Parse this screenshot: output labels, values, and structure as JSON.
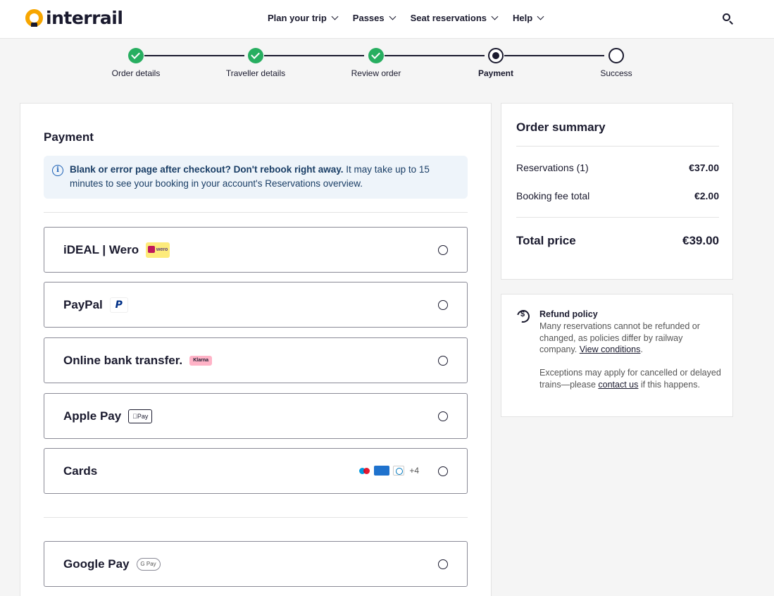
{
  "header": {
    "logo_text": "interrail",
    "nav": [
      "Plan your trip",
      "Passes",
      "Seat reservations",
      "Help"
    ]
  },
  "stepper": {
    "steps": [
      {
        "label": "Order details",
        "state": "done"
      },
      {
        "label": "Traveller details",
        "state": "done"
      },
      {
        "label": "Review order",
        "state": "done"
      },
      {
        "label": "Payment",
        "state": "current"
      },
      {
        "label": "Success",
        "state": "todo"
      }
    ]
  },
  "payment": {
    "title": "Payment",
    "notice_bold": "Blank or error page after checkout? Don't rebook right away.",
    "notice_text": " It may take up to 15 minutes to see your booking in your account's Reservations overview.",
    "methods": [
      {
        "label": "iDEAL | Wero",
        "badge": "wero"
      },
      {
        "label": "PayPal",
        "badge": "P"
      },
      {
        "label": "Online bank transfer.",
        "badge": "Klarna"
      },
      {
        "label": "Apple Pay",
        "badge": "Pay"
      },
      {
        "label": "Cards",
        "extra": "+4"
      },
      {
        "label": "Google Pay",
        "badge": "G Pay"
      }
    ]
  },
  "summary": {
    "title": "Order summary",
    "rows": [
      {
        "label": "Reservations (1)",
        "amount": "€37.00"
      },
      {
        "label": "Booking fee total",
        "amount": "€2.00"
      }
    ],
    "total_label": "Total price",
    "total_amount": "€39.00"
  },
  "refund": {
    "title": "Refund policy",
    "text1": "Many reservations cannot be refunded or changed, as policies differ by railway company. ",
    "link1": "View conditions",
    "text1_end": ".",
    "text2": "Exceptions may apply for cancelled or delayed trains—please ",
    "link2": "contact us",
    "text2_end": " if this happens."
  },
  "colors": {
    "accent": "#f7a600",
    "done": "#27ae60",
    "text": "#1a1a2e",
    "notice_bg": "#eef4fa"
  }
}
